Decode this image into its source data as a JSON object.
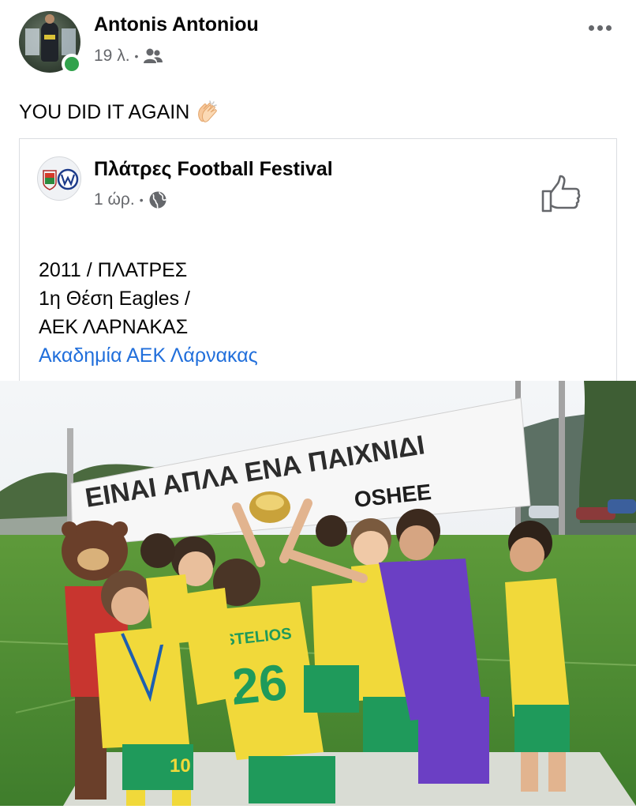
{
  "post": {
    "author": "Antonis Antoniou",
    "time": "19 λ.",
    "separator": "•",
    "audience_icon": "friends-icon",
    "text": "YOU DID IT AGAIN",
    "emoji_icon": "clap-icon"
  },
  "shared": {
    "page_name": "Πλάτρες Football Festival",
    "time": "1 ώρ.",
    "separator": "•",
    "audience_icon": "globe-icon",
    "lines": [
      "2011 / ΠΛΑΤΡΕΣ",
      "1η Θέση Eagles /",
      "ΑΕΚ ΛΑΡΝΑΚΑΣ"
    ],
    "hashtag": "Ακαδημία ΑΕΚ Λάρνακας"
  },
  "photo": {
    "banner_text": "ΕΙΝΑΙ ΑΠΛΑ ΕΝΑ ΠΑΙΧΝΙΔΙ",
    "sponsor_text": "OSHEE",
    "jersey_number": "26",
    "jersey_name": "STELIOS",
    "shorts_number": "10"
  },
  "colors": {
    "online": "#31a24c",
    "link": "#216fdb",
    "meta": "#65676b",
    "kit_yellow": "#f1d93a",
    "kit_green": "#1f9a5b",
    "keeper_purple": "#6b3fc4"
  }
}
